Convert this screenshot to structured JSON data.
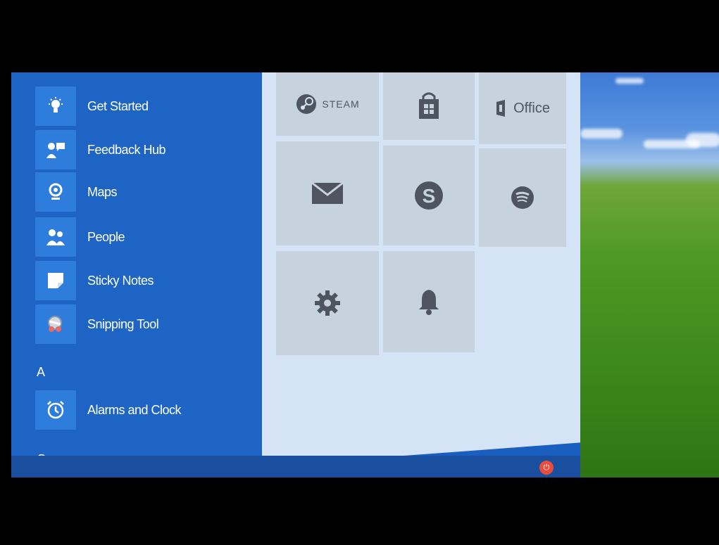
{
  "apps": [
    {
      "label": "Get Started",
      "icon": "lightbulb-icon"
    },
    {
      "label": "Feedback Hub",
      "icon": "feedback-icon"
    },
    {
      "label": "Maps",
      "icon": "maps-icon"
    },
    {
      "label": "People",
      "icon": "people-icon"
    },
    {
      "label": "Sticky Notes",
      "icon": "sticky-notes-icon"
    },
    {
      "label": "Snipping Tool",
      "icon": "snipping-tool-icon"
    }
  ],
  "sections": {
    "a_letter": "A",
    "c_letter": "C"
  },
  "a_apps": [
    {
      "label": "Alarms and Clock",
      "icon": "alarm-clock-icon"
    }
  ],
  "tiles": {
    "steam_label": "STEAM",
    "office_label": "Office"
  },
  "colors": {
    "start_menu_blue": "#1d64c4",
    "tile_bg": "#c7d2df",
    "power_red": "#e74c3c"
  }
}
